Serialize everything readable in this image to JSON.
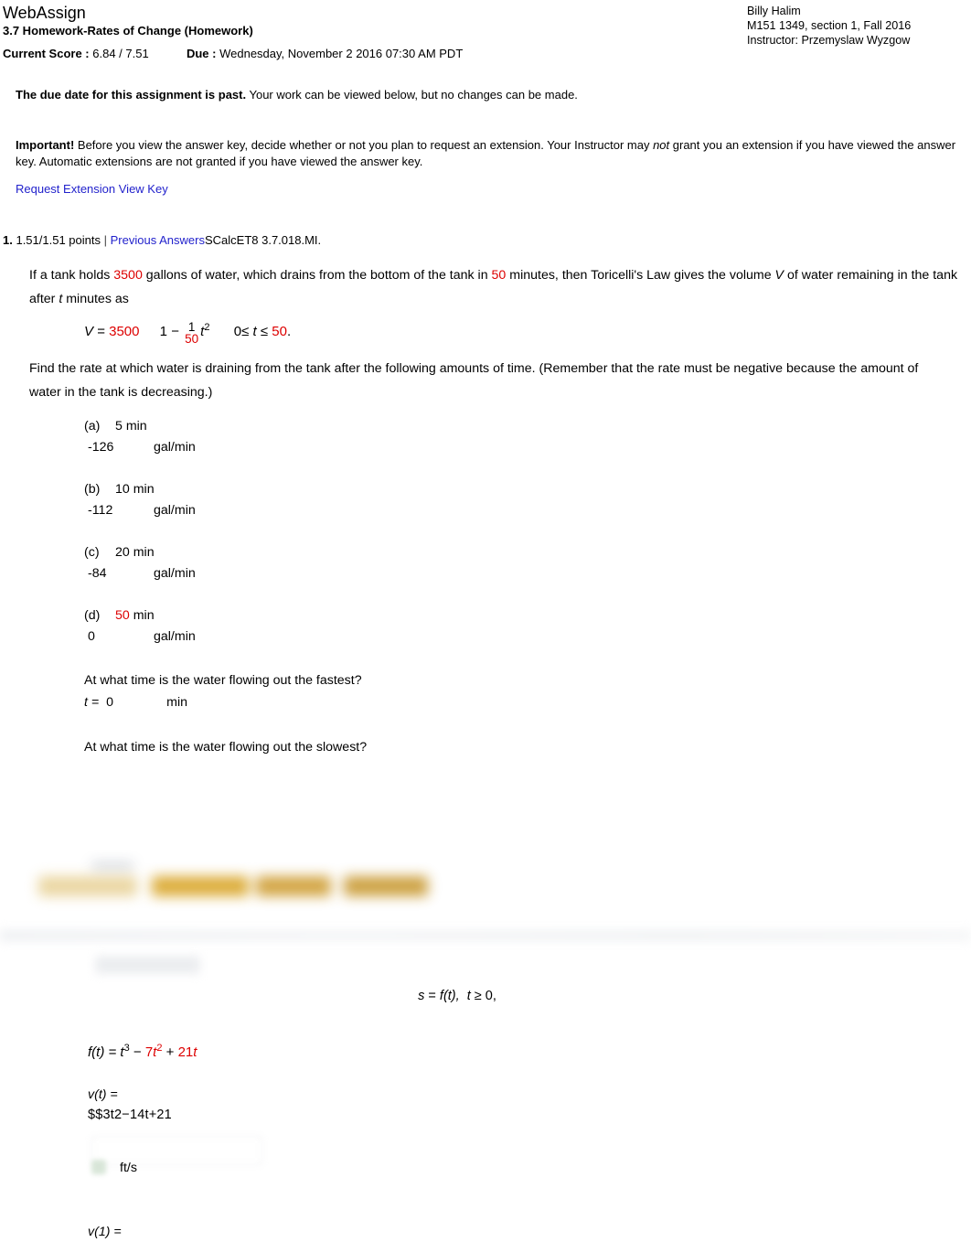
{
  "header": {
    "site_name": "WebAssign",
    "assignment_title": "3.7 Homework-Rates of Change (Homework)",
    "current_score_label": "Current Score :",
    "current_score_value": "6.84 / 7.51",
    "due_label": "Due :",
    "due_value": "Wednesday, November 2 2016 07:30 AM PDT",
    "student_name": "Billy Halim",
    "course": "M151 1349, section 1, Fall 2016",
    "instructor": "Instructor: Przemyslaw Wyzgow"
  },
  "notices": {
    "past_due_bold": "The due date for this assignment is past.",
    "past_due_rest": " Your work can be viewed below, but no changes can be made.",
    "important_bold": "Important!",
    "important_part1": " Before you view the answer key, decide whether or not you plan to request an extension. Your Instructor may ",
    "important_italic": "not",
    "important_part2": " grant you an extension if you have viewed the answer key. Automatic extensions are not granted if you have viewed the answer key.",
    "request_extension_link": "Request Extension",
    "view_key_link": "View Key"
  },
  "question": {
    "number": "1.",
    "points": "1.51/1.51 points",
    "divider": "|",
    "previous_answers_link": "Previous Answers",
    "textbook_ref": "SCalcET8 3.7.018.MI.",
    "stem_part1": "If a tank holds ",
    "gallons": "3500",
    "stem_part2": " gallons of water, which drains from the bottom of the tank in ",
    "minutes": "50",
    "stem_part3": " minutes, then Toricelli's Law gives the volume ",
    "var_V": "V",
    "stem_part4": " of water remaining in the tank after ",
    "var_t": "t",
    "stem_part5": " minutes as",
    "formula": {
      "lhs": "V",
      "equals": "=",
      "coefficient": "3500",
      "open_paren": "(",
      "one": "1",
      "minus": "−",
      "frac_num": "1",
      "frac_den": "50",
      "frac_var": "t",
      "close_paren": ")",
      "exponent": "2",
      "domain_lo": "0",
      "domain_le1": "≤",
      "domain_var": "t",
      "domain_le2": "≤",
      "domain_hi": "50",
      "period": "."
    },
    "prompt": "Find the rate at which water is draining from the tank after the following amounts of time. (Remember that the rate must be negative because the amount of water in the tank is decreasing.)",
    "parts": [
      {
        "label": "(a)",
        "time": "5 min",
        "time_red": false,
        "answer": "-126",
        "unit": "gal/min"
      },
      {
        "label": "(b)",
        "time": "10 min",
        "time_red": false,
        "answer": "-112",
        "unit": "gal/min"
      },
      {
        "label": "(c)",
        "time": "20 min",
        "time_red": false,
        "answer": "-84",
        "unit": "gal/min"
      },
      {
        "label": "(d)",
        "time_red_value": "50",
        "time_rest": " min",
        "time_red": true,
        "answer": "0",
        "unit": "gal/min"
      }
    ],
    "fastest_question": "At what time is the water flowing out the fastest?",
    "fastest_var": "t =",
    "fastest_answer": "0",
    "fastest_unit": "min",
    "slowest_question": "At what time is the water flowing out the slowest?"
  },
  "question2": {
    "motion_equation": "s = f(t),   t ≥ 0,",
    "motion_s": "s",
    "motion_eq": " = ",
    "motion_f": "f",
    "motion_tparen": "(t),",
    "motion_t2": "t",
    "motion_ge": " ≥ 0,",
    "ft_lhs": "f(t) = ",
    "ft_t": "t",
    "ft_exp3": "3",
    "ft_minus": " − ",
    "ft_seven": "7",
    "ft_t2": "t",
    "ft_exp2": "2",
    "ft_plus": " + ",
    "ft_21": "21",
    "ft_t3": "t",
    "vt_label": "v(t) =",
    "vt_raw": "$$3t2−14t+21",
    "vt_unit": "ft/s",
    "v1_label": "v(1) ="
  }
}
